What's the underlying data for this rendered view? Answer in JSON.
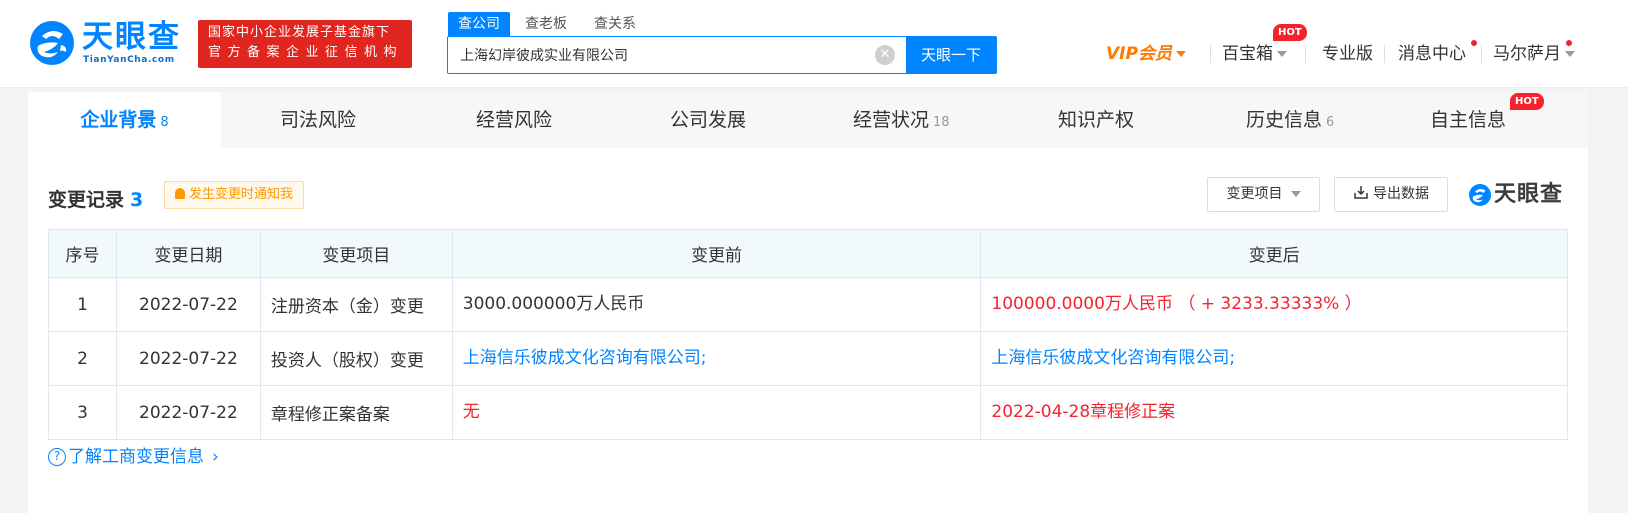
{
  "header": {
    "logo_name": "天眼查",
    "logo_domain": "TianYanCha.com",
    "slogan_line1": "国家中小企业发展子基金旗下",
    "slogan_line2": "官方备案企业征信机构",
    "search_tabs": [
      "查公司",
      "查老板",
      "查关系"
    ],
    "search_value": "上海幻岸彼成实业有限公司",
    "search_button": "天眼一下",
    "nav": {
      "vip": "VIP会员",
      "treasure": "百宝箱",
      "treasure_badge": "HOT",
      "pro": "专业版",
      "messages": "消息中心",
      "user": "马尔萨月"
    }
  },
  "tabs": [
    {
      "label": "企业背景",
      "count": "8"
    },
    {
      "label": "司法风险",
      "count": ""
    },
    {
      "label": "经营风险",
      "count": ""
    },
    {
      "label": "公司发展",
      "count": ""
    },
    {
      "label": "经营状况",
      "count": "18"
    },
    {
      "label": "知识产权",
      "count": ""
    },
    {
      "label": "历史信息",
      "count": "6"
    },
    {
      "label": "自主信息",
      "count": "",
      "badge": "HOT"
    }
  ],
  "section": {
    "title": "变更记录",
    "count": "3",
    "notify_label": "发生变更时通知我",
    "filter_label": "变更项目",
    "export_label": "导出数据",
    "brand": "天眼查"
  },
  "table": {
    "headers": [
      "序号",
      "变更日期",
      "变更项目",
      "变更前",
      "变更后"
    ],
    "rows": [
      {
        "no": "1",
        "date": "2022-07-22",
        "item": "注册资本（金）变更",
        "before": "3000.000000万人民币",
        "after": "100000.0000万人民币 （ + 3233.33333% ）"
      },
      {
        "no": "2",
        "date": "2022-07-22",
        "item": "投资人（股权）变更",
        "before": "上海信乐彼成文化咨询有限公司;",
        "after": "上海信乐彼成文化咨询有限公司;"
      },
      {
        "no": "3",
        "date": "2022-07-22",
        "item": "章程修正案备案",
        "before": "无",
        "after": "2022-04-28章程修正案"
      }
    ]
  },
  "help_link": "了解工商变更信息",
  "colors": {
    "brand_blue": "#0084ff",
    "hot_red": "#f5222d",
    "vip_orange": "#ff7a00",
    "slogan_red": "#e0261f"
  }
}
